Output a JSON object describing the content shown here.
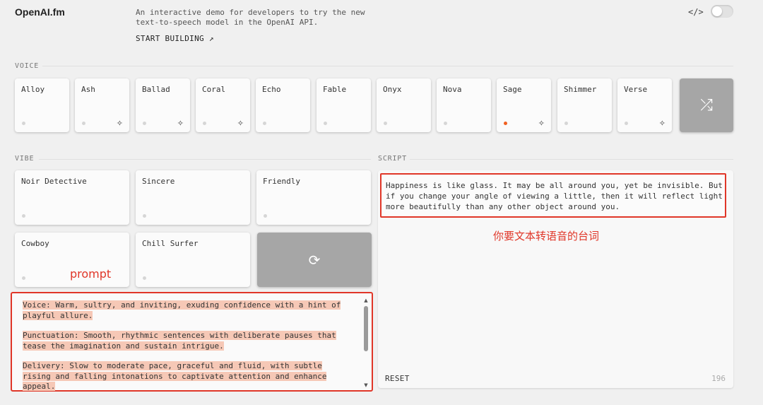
{
  "header": {
    "logo": "OpenAI.fm",
    "description": "An interactive demo for developers to try the new text-to-speech model in the OpenAI API.",
    "start_building": "START BUILDING ↗",
    "code_icon": "code-icon",
    "toggle_state": "off"
  },
  "voice": {
    "label": "VOICE",
    "items": [
      {
        "name": "Alloy",
        "sparkle": false,
        "selected": false
      },
      {
        "name": "Ash",
        "sparkle": true,
        "selected": false
      },
      {
        "name": "Ballad",
        "sparkle": true,
        "selected": false
      },
      {
        "name": "Coral",
        "sparkle": true,
        "selected": false
      },
      {
        "name": "Echo",
        "sparkle": false,
        "selected": false
      },
      {
        "name": "Fable",
        "sparkle": false,
        "selected": false
      },
      {
        "name": "Onyx",
        "sparkle": false,
        "selected": false
      },
      {
        "name": "Nova",
        "sparkle": false,
        "selected": false
      },
      {
        "name": "Sage",
        "sparkle": true,
        "selected": true
      },
      {
        "name": "Shimmer",
        "sparkle": false,
        "selected": false
      },
      {
        "name": "Verse",
        "sparkle": true,
        "selected": false
      }
    ],
    "shuffle_icon": "shuffle-icon"
  },
  "vibe": {
    "label": "VIBE",
    "items": [
      "Noir Detective",
      "Sincere",
      "Friendly",
      "Cowboy",
      "Chill Surfer"
    ],
    "refresh_icon": "refresh-icon",
    "prompt": [
      "Voice: Warm, sultry, and inviting, exuding confidence with a hint of playful allure.",
      "Punctuation: Smooth, rhythmic sentences with deliberate pauses that tease the imagination and sustain intrigue.",
      "Delivery: Slow to moderate pace, graceful and fluid, with subtle rising and falling intonations to captivate attention and enhance appeal."
    ]
  },
  "script": {
    "label": "SCRIPT",
    "text": "Happiness is like glass. It may be all around you, yet be invisible. But if you change your angle of viewing a little, then it will reflect light more beautifully than any other object around you.",
    "reset": "RESET",
    "count": "196"
  },
  "annotations": {
    "prompt": "prompt",
    "script": "你要文本转语音的台词"
  },
  "colors": {
    "accent": "#f06020",
    "annotation": "#e03628",
    "highlight": "#f6c8b6",
    "gray_button": "#a6a6a6"
  }
}
